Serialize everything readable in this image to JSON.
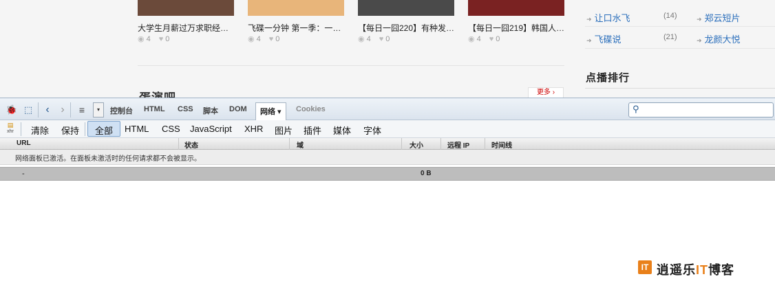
{
  "page": {
    "videos": [
      {
        "title": "大学生月薪过万求职经…",
        "views": "4",
        "likes": "0",
        "thumb_color": "#6b4a3a"
      },
      {
        "title": "飞碟一分钟 第一季：一…",
        "views": "4",
        "likes": "0",
        "thumb_color": "#e8b57a"
      },
      {
        "title": "【每日一囧220】有种发…",
        "views": "4",
        "likes": "0",
        "thumb_color": "#4a4a4a"
      },
      {
        "title": "【每日一囧219】韩国人…",
        "views": "4",
        "likes": "0",
        "thumb_color": "#7a2222"
      }
    ],
    "section_title": "蛋演吧",
    "more_label": "更多 ›",
    "side_links": [
      {
        "label": "让口水飞",
        "count": "(14)"
      },
      {
        "label": "郑云短片",
        "count": ""
      },
      {
        "label": "飞碟说",
        "count": "(21)"
      },
      {
        "label": "龙颜大悦",
        "count": ""
      }
    ],
    "rank_title": "点播排行"
  },
  "firebug": {
    "toolbar": {
      "tabs": [
        {
          "label": "控制台",
          "active": false
        },
        {
          "label": "HTML",
          "active": false
        },
        {
          "label": "CSS",
          "active": false
        },
        {
          "label": "脚本",
          "active": false
        },
        {
          "label": "DOM",
          "active": false
        },
        {
          "label": "网络 ▾",
          "active": true
        },
        {
          "label": "Cookies",
          "active": false
        }
      ],
      "search_placeholder": ""
    },
    "filter": {
      "xhr_icon_label": "xhr",
      "actions": [
        "清除",
        "保持"
      ],
      "types": [
        "全部",
        "HTML",
        "CSS",
        "JavaScript",
        "XHR",
        "图片",
        "插件",
        "媒体",
        "字体"
      ],
      "active_type": "全部"
    },
    "columns": [
      "URL",
      "状态",
      "域",
      "大小",
      "远程 IP",
      "时间线"
    ],
    "message": "网络面板已激活。在面板未激活时的任何请求都不会被显示。",
    "summary": {
      "dash": "-",
      "size": "0 B"
    }
  },
  "watermark": {
    "logo": "IT",
    "text_before": "逍遥乐",
    "text_it": "IT",
    "text_after": "博客"
  },
  "colors": {
    "link": "#2a6ebb",
    "accent": "#e9801a",
    "toolbar": "#dbe4ee"
  }
}
